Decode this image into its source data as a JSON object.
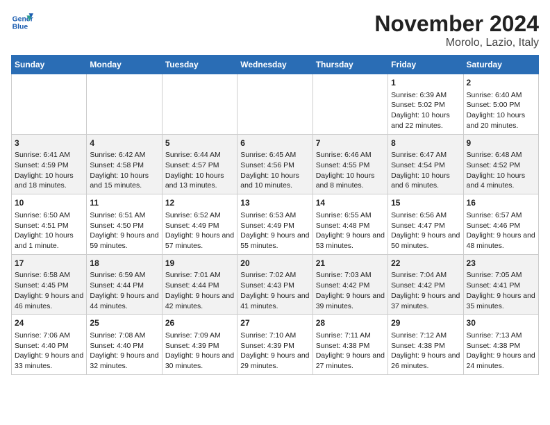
{
  "header": {
    "logo_line1": "General",
    "logo_line2": "Blue",
    "month": "November 2024",
    "location": "Morolo, Lazio, Italy"
  },
  "weekdays": [
    "Sunday",
    "Monday",
    "Tuesday",
    "Wednesday",
    "Thursday",
    "Friday",
    "Saturday"
  ],
  "weeks": [
    [
      {
        "day": "",
        "info": ""
      },
      {
        "day": "",
        "info": ""
      },
      {
        "day": "",
        "info": ""
      },
      {
        "day": "",
        "info": ""
      },
      {
        "day": "",
        "info": ""
      },
      {
        "day": "1",
        "info": "Sunrise: 6:39 AM\nSunset: 5:02 PM\nDaylight: 10 hours and 22 minutes."
      },
      {
        "day": "2",
        "info": "Sunrise: 6:40 AM\nSunset: 5:00 PM\nDaylight: 10 hours and 20 minutes."
      }
    ],
    [
      {
        "day": "3",
        "info": "Sunrise: 6:41 AM\nSunset: 4:59 PM\nDaylight: 10 hours and 18 minutes."
      },
      {
        "day": "4",
        "info": "Sunrise: 6:42 AM\nSunset: 4:58 PM\nDaylight: 10 hours and 15 minutes."
      },
      {
        "day": "5",
        "info": "Sunrise: 6:44 AM\nSunset: 4:57 PM\nDaylight: 10 hours and 13 minutes."
      },
      {
        "day": "6",
        "info": "Sunrise: 6:45 AM\nSunset: 4:56 PM\nDaylight: 10 hours and 10 minutes."
      },
      {
        "day": "7",
        "info": "Sunrise: 6:46 AM\nSunset: 4:55 PM\nDaylight: 10 hours and 8 minutes."
      },
      {
        "day": "8",
        "info": "Sunrise: 6:47 AM\nSunset: 4:54 PM\nDaylight: 10 hours and 6 minutes."
      },
      {
        "day": "9",
        "info": "Sunrise: 6:48 AM\nSunset: 4:52 PM\nDaylight: 10 hours and 4 minutes."
      }
    ],
    [
      {
        "day": "10",
        "info": "Sunrise: 6:50 AM\nSunset: 4:51 PM\nDaylight: 10 hours and 1 minute."
      },
      {
        "day": "11",
        "info": "Sunrise: 6:51 AM\nSunset: 4:50 PM\nDaylight: 9 hours and 59 minutes."
      },
      {
        "day": "12",
        "info": "Sunrise: 6:52 AM\nSunset: 4:49 PM\nDaylight: 9 hours and 57 minutes."
      },
      {
        "day": "13",
        "info": "Sunrise: 6:53 AM\nSunset: 4:49 PM\nDaylight: 9 hours and 55 minutes."
      },
      {
        "day": "14",
        "info": "Sunrise: 6:55 AM\nSunset: 4:48 PM\nDaylight: 9 hours and 53 minutes."
      },
      {
        "day": "15",
        "info": "Sunrise: 6:56 AM\nSunset: 4:47 PM\nDaylight: 9 hours and 50 minutes."
      },
      {
        "day": "16",
        "info": "Sunrise: 6:57 AM\nSunset: 4:46 PM\nDaylight: 9 hours and 48 minutes."
      }
    ],
    [
      {
        "day": "17",
        "info": "Sunrise: 6:58 AM\nSunset: 4:45 PM\nDaylight: 9 hours and 46 minutes."
      },
      {
        "day": "18",
        "info": "Sunrise: 6:59 AM\nSunset: 4:44 PM\nDaylight: 9 hours and 44 minutes."
      },
      {
        "day": "19",
        "info": "Sunrise: 7:01 AM\nSunset: 4:44 PM\nDaylight: 9 hours and 42 minutes."
      },
      {
        "day": "20",
        "info": "Sunrise: 7:02 AM\nSunset: 4:43 PM\nDaylight: 9 hours and 41 minutes."
      },
      {
        "day": "21",
        "info": "Sunrise: 7:03 AM\nSunset: 4:42 PM\nDaylight: 9 hours and 39 minutes."
      },
      {
        "day": "22",
        "info": "Sunrise: 7:04 AM\nSunset: 4:42 PM\nDaylight: 9 hours and 37 minutes."
      },
      {
        "day": "23",
        "info": "Sunrise: 7:05 AM\nSunset: 4:41 PM\nDaylight: 9 hours and 35 minutes."
      }
    ],
    [
      {
        "day": "24",
        "info": "Sunrise: 7:06 AM\nSunset: 4:40 PM\nDaylight: 9 hours and 33 minutes."
      },
      {
        "day": "25",
        "info": "Sunrise: 7:08 AM\nSunset: 4:40 PM\nDaylight: 9 hours and 32 minutes."
      },
      {
        "day": "26",
        "info": "Sunrise: 7:09 AM\nSunset: 4:39 PM\nDaylight: 9 hours and 30 minutes."
      },
      {
        "day": "27",
        "info": "Sunrise: 7:10 AM\nSunset: 4:39 PM\nDaylight: 9 hours and 29 minutes."
      },
      {
        "day": "28",
        "info": "Sunrise: 7:11 AM\nSunset: 4:38 PM\nDaylight: 9 hours and 27 minutes."
      },
      {
        "day": "29",
        "info": "Sunrise: 7:12 AM\nSunset: 4:38 PM\nDaylight: 9 hours and 26 minutes."
      },
      {
        "day": "30",
        "info": "Sunrise: 7:13 AM\nSunset: 4:38 PM\nDaylight: 9 hours and 24 minutes."
      }
    ]
  ]
}
